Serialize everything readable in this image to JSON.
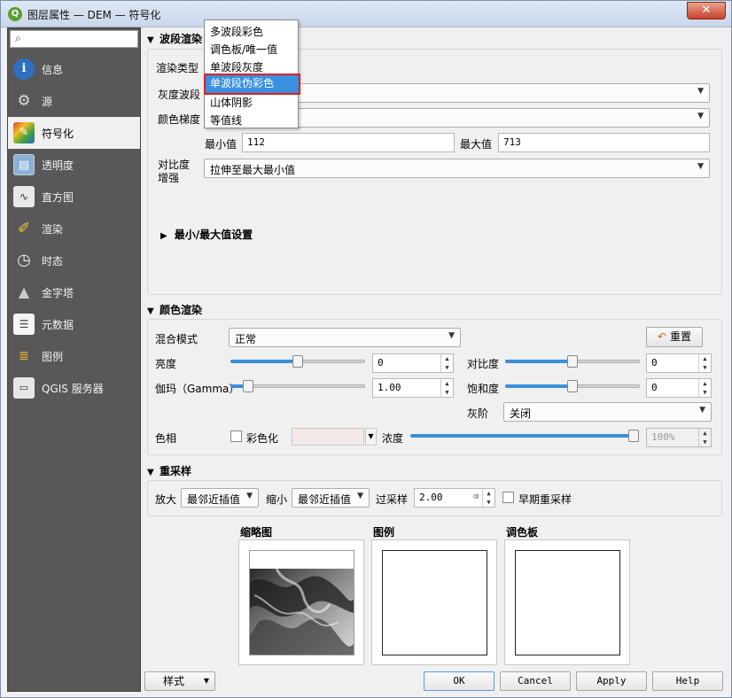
{
  "window": {
    "title": "图层属性 — DEM — 符号化",
    "close_glyph": "✕"
  },
  "sidebar": {
    "search_placeholder": "",
    "items": [
      {
        "label": "信息",
        "icon": "info-icon"
      },
      {
        "label": "源",
        "icon": "source-gear-icon"
      },
      {
        "label": "符号化",
        "icon": "symbology-brush-icon"
      },
      {
        "label": "透明度",
        "icon": "transparency-icon"
      },
      {
        "label": "直方图",
        "icon": "histogram-icon"
      },
      {
        "label": "渲染",
        "icon": "rendering-brush-icon"
      },
      {
        "label": "时态",
        "icon": "clock-icon"
      },
      {
        "label": "金字塔",
        "icon": "pyramid-icon"
      },
      {
        "label": "元数据",
        "icon": "metadata-icon"
      },
      {
        "label": "图例",
        "icon": "legend-icon"
      },
      {
        "label": "QGIS 服务器",
        "icon": "qgis-server-icon"
      }
    ],
    "active_index": 2
  },
  "band_render": {
    "header": "波段渲染",
    "render_type_label": "渲染类型",
    "gray_band_label": "灰度波段",
    "color_gradient_label": "颜色梯度",
    "min_label": "最小值",
    "min_value": "112",
    "max_label": "最大值",
    "max_value": "713",
    "contrast_label_1": "对比度",
    "contrast_label_2": "增强",
    "contrast_value": "拉伸至最大最小值",
    "minmax_settings": "最小/最大值设置"
  },
  "render_type_menu": {
    "options": [
      "多波段彩色",
      "调色板/唯一值",
      "单波段灰度",
      "单波段伪彩色",
      "山体阴影",
      "等值线"
    ],
    "highlighted_index": 3
  },
  "color_render": {
    "header": "颜色渲染",
    "blend_label": "混合模式",
    "blend_value": "正常",
    "reset_label": "重置",
    "brightness_label": "亮度",
    "brightness_value": "0",
    "brightness_level": 0.5,
    "contrast_label": "对比度",
    "contrast_value": "0",
    "contrast_level": 0.5,
    "gamma_label": "伽玛（Gamma）",
    "gamma_value": "1.00",
    "gamma_level": 0.1,
    "saturation_label": "饱和度",
    "saturation_value": "0",
    "saturation_level": 0.5,
    "grayscale_label": "灰阶",
    "grayscale_value": "关闭",
    "hue_label": "色相",
    "colorize_label": "彩色化",
    "strength_label": "浓度",
    "strength_value": "100%",
    "strength_level": 1.0
  },
  "resample": {
    "header": "重采样",
    "zoom_in_label": "放大",
    "zoom_in_value": "最邻近插值",
    "zoom_out_label": "缩小",
    "zoom_out_value": "最邻近插值",
    "oversample_label": "过采样",
    "oversample_value": "2.00",
    "early_resample_label": "早期重采样"
  },
  "previews": {
    "thumbnail_label": "缩略图",
    "legend_label": "图例",
    "palette_label": "调色板"
  },
  "footer": {
    "style_label": "样式",
    "ok_label": "OK",
    "cancel_label": "Cancel",
    "apply_label": "Apply",
    "help_label": "Help"
  },
  "colors": {
    "sidebar_bg": "#585858",
    "highlight": "#3b8fe0",
    "highlight_outline": "#e0201a",
    "slider_fill": "#3a8fd9"
  }
}
